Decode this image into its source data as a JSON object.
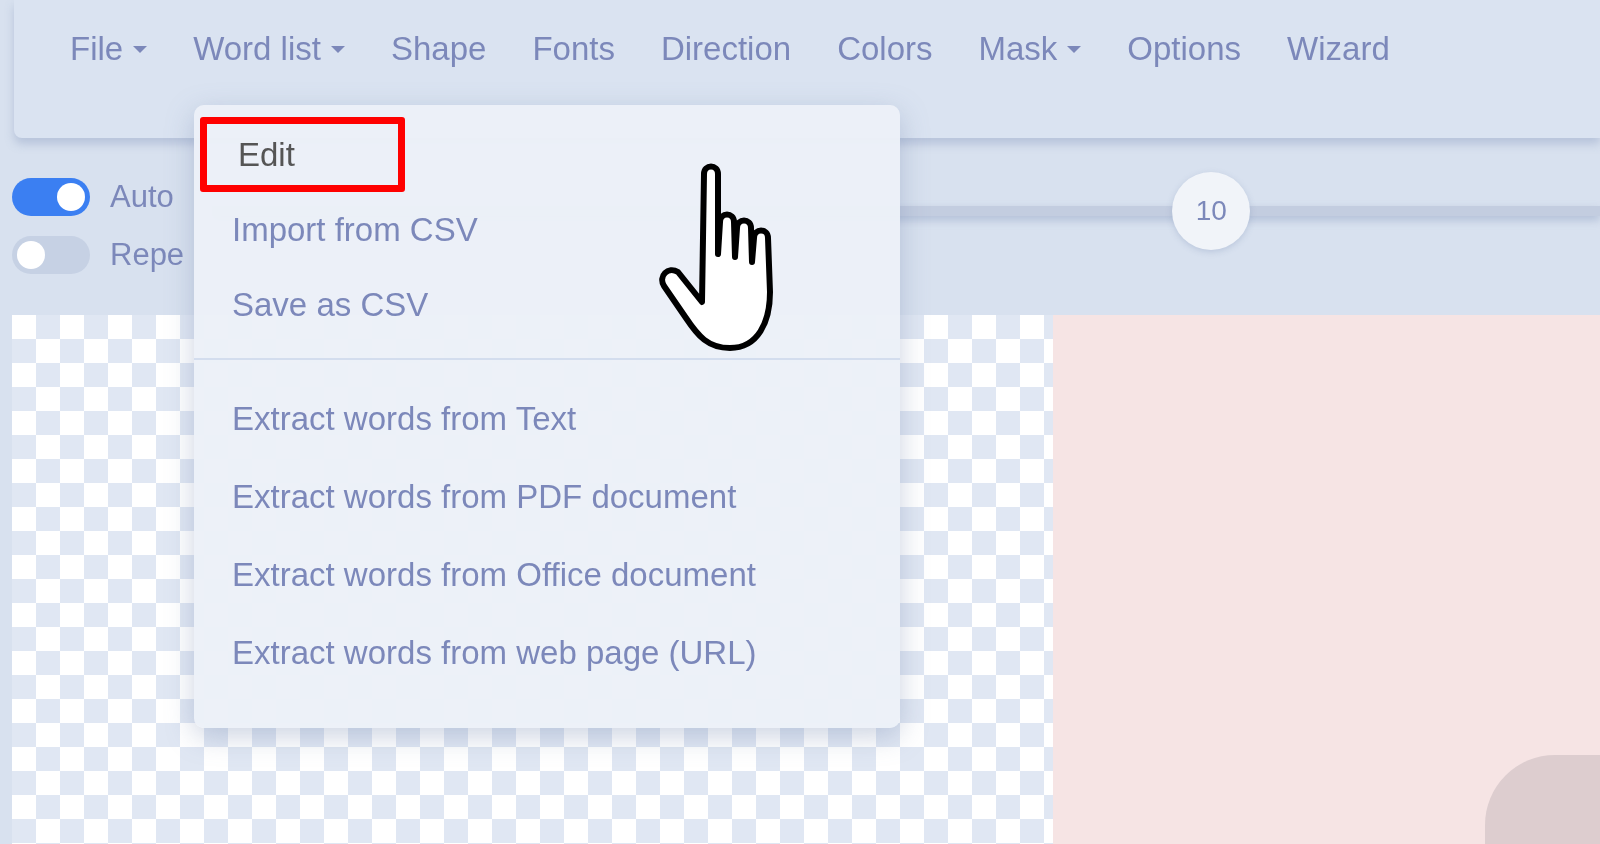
{
  "navbar": {
    "items": [
      {
        "label": "File",
        "dropdown": true
      },
      {
        "label": "Word list",
        "dropdown": true
      },
      {
        "label": "Shape",
        "dropdown": false
      },
      {
        "label": "Fonts",
        "dropdown": false
      },
      {
        "label": "Direction",
        "dropdown": false
      },
      {
        "label": "Colors",
        "dropdown": false
      },
      {
        "label": "Mask",
        "dropdown": true
      },
      {
        "label": "Options",
        "dropdown": false
      },
      {
        "label": "Wizard",
        "dropdown": false
      }
    ]
  },
  "toggles": [
    {
      "label": "Auto",
      "on": true
    },
    {
      "label": "Repe",
      "on": false
    }
  ],
  "slider": {
    "reading": "10",
    "level": 0.72
  },
  "dropdown_menu": {
    "groups": [
      [
        {
          "label": "Edit",
          "selected": true
        },
        {
          "label": "Import from CSV",
          "selected": false
        },
        {
          "label": "Save as CSV",
          "selected": false
        }
      ],
      [
        {
          "label": "Extract words from Text",
          "selected": false
        },
        {
          "label": "Extract words from PDF document",
          "selected": false
        },
        {
          "label": "Extract words from Office document",
          "selected": false
        },
        {
          "label": "Extract words from web page (URL)",
          "selected": false
        }
      ]
    ]
  }
}
